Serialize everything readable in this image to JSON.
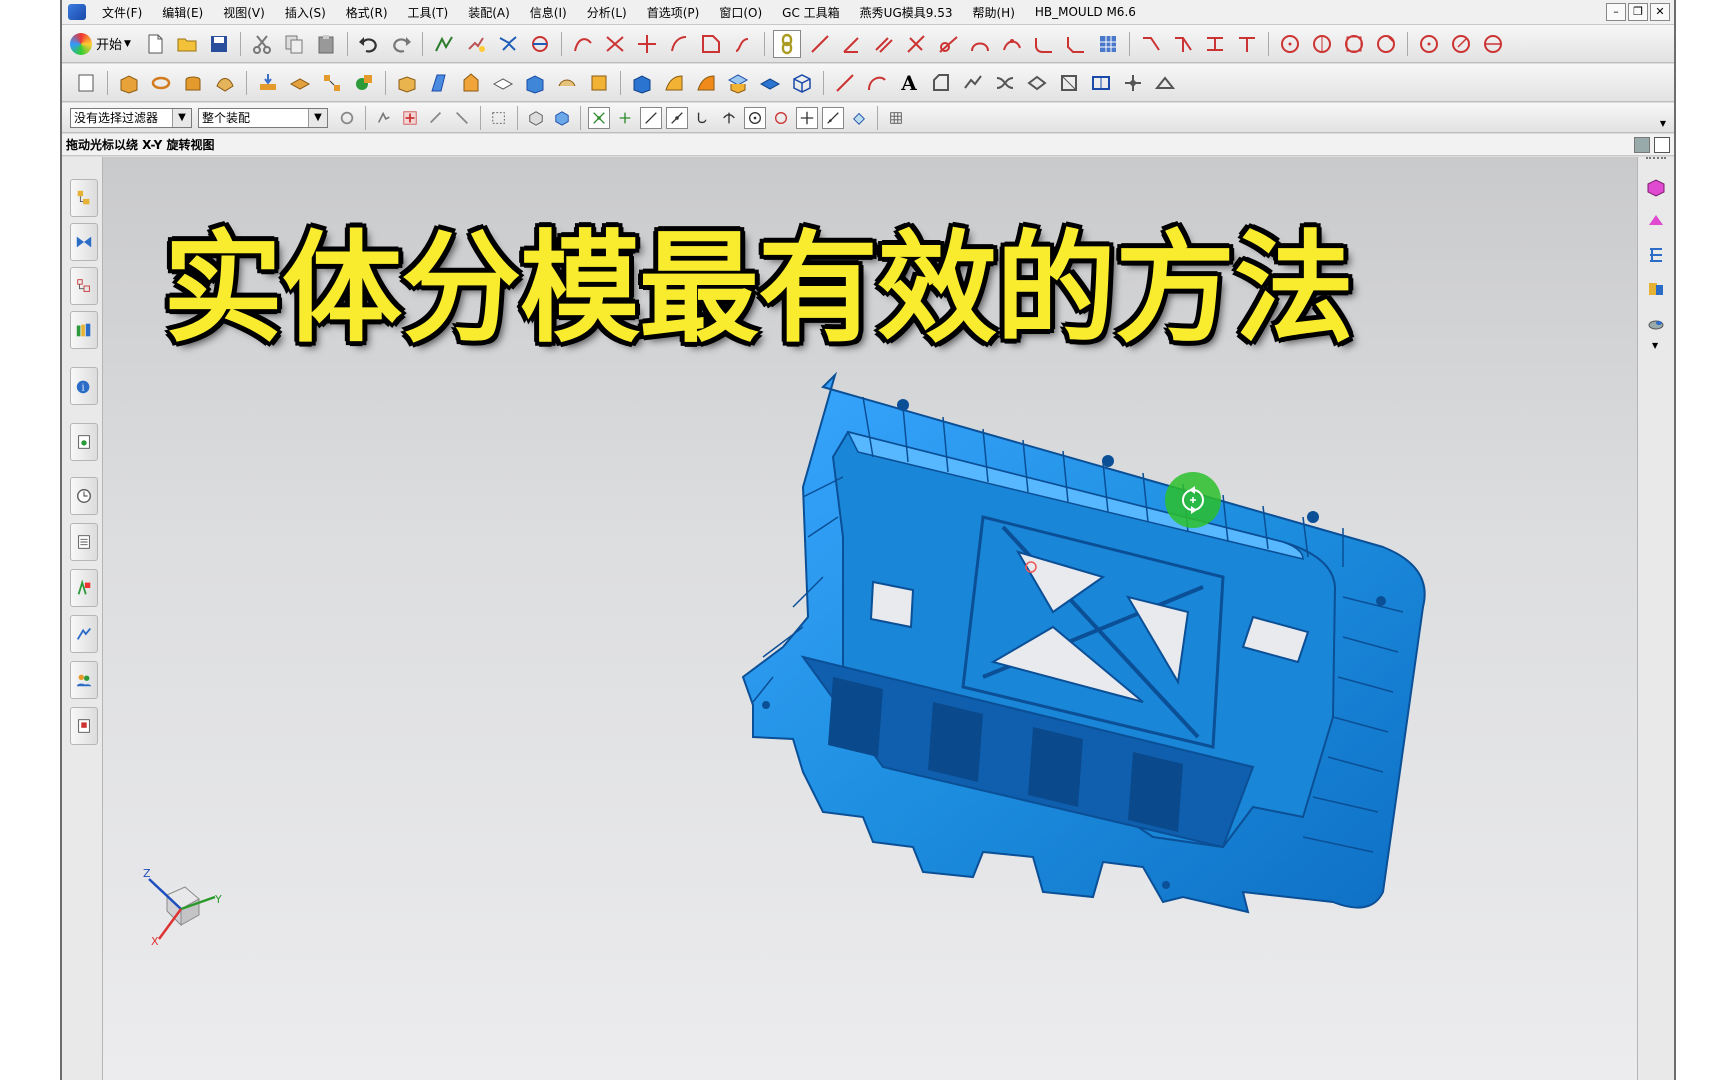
{
  "menu": {
    "items": [
      "文件(F)",
      "编辑(E)",
      "视图(V)",
      "插入(S)",
      "格式(R)",
      "工具(T)",
      "装配(A)",
      "信息(I)",
      "分析(L)",
      "首选项(P)",
      "窗口(O)",
      "GC 工具箱",
      "燕秀UG模具9.53",
      "帮助(H)",
      "HB_MOULD M6.6"
    ]
  },
  "toolbar": {
    "start_label": "开始",
    "filter_select": "没有选择过滤器",
    "scope_select": "整个装配"
  },
  "cue_line": {
    "text": "拖动光标以绕 X-Y 旋转视图"
  },
  "overlay": {
    "headline": "实体分模最有效的方法"
  },
  "triad": {
    "x_label": "X",
    "y_label": "Y",
    "z_label": "Z"
  },
  "colors": {
    "part_blue": "#1e8fe0",
    "part_dark": "#0b4f96",
    "headline_yellow": "#f9ec2e",
    "rotate_cursor": "#2bbf2b"
  }
}
